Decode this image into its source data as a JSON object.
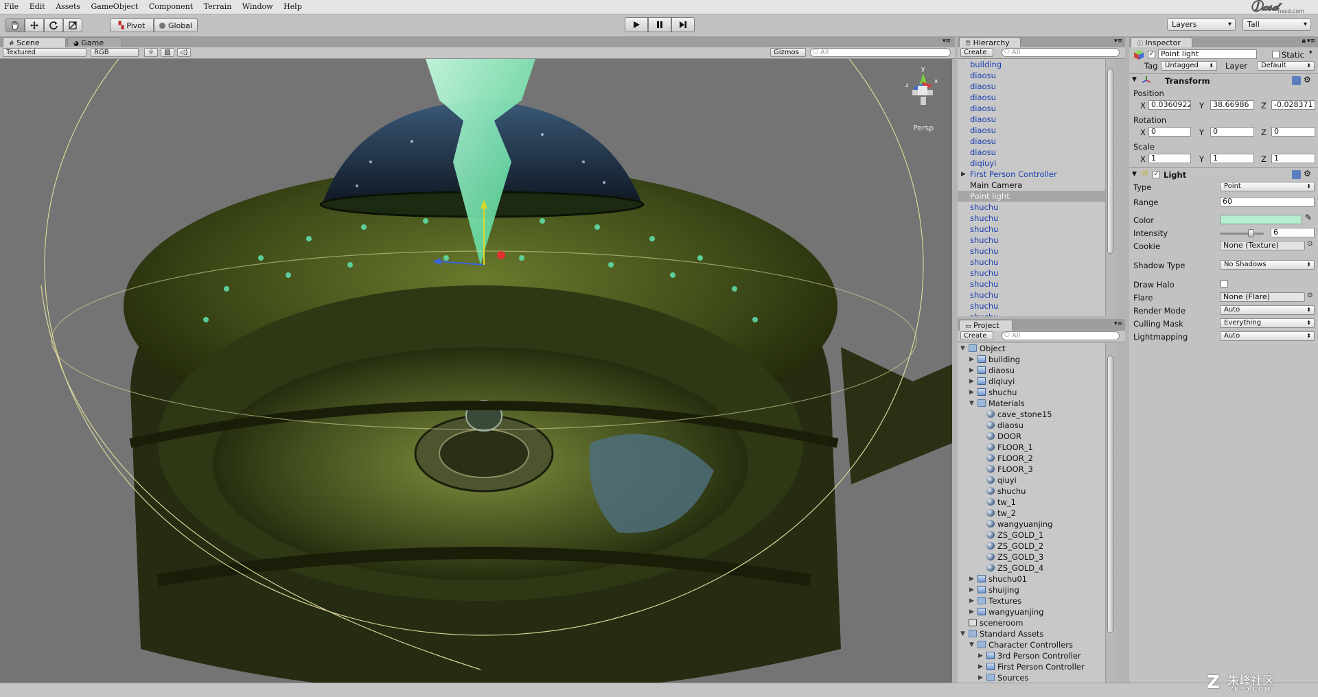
{
  "menu": [
    "File",
    "Edit",
    "Assets",
    "GameObject",
    "Component",
    "Terrain",
    "Window",
    "Help"
  ],
  "toolbar": {
    "pivot_label": "Pivot",
    "global_label": "Global",
    "layers_label": "Layers",
    "layout_label": "Tall"
  },
  "scene_panel": {
    "tab_scene": "Scene",
    "tab_game": "Game",
    "render_mode": "Textured",
    "color_mode": "RGB",
    "gizmos_label": "Gizmos",
    "search_placeholder": "All",
    "persp_label": "Persp"
  },
  "hierarchy": {
    "tab": "Hierarchy",
    "create": "Create",
    "search_placeholder": "All",
    "items": [
      {
        "label": "building",
        "style": "blue"
      },
      {
        "label": "diaosu",
        "style": "blue"
      },
      {
        "label": "diaosu",
        "style": "blue"
      },
      {
        "label": "diaosu",
        "style": "blue"
      },
      {
        "label": "diaosu",
        "style": "blue"
      },
      {
        "label": "diaosu",
        "style": "blue"
      },
      {
        "label": "diaosu",
        "style": "blue"
      },
      {
        "label": "diaosu",
        "style": "blue"
      },
      {
        "label": "diaosu",
        "style": "blue"
      },
      {
        "label": "diqiuyi",
        "style": "blue"
      },
      {
        "label": "First Person Controller",
        "style": "blue",
        "expand": true
      },
      {
        "label": "Main Camera",
        "style": "black"
      },
      {
        "label": "Point light",
        "style": "selected"
      },
      {
        "label": "shuchu",
        "style": "blue"
      },
      {
        "label": "shuchu",
        "style": "blue"
      },
      {
        "label": "shuchu",
        "style": "blue"
      },
      {
        "label": "shuchu",
        "style": "blue"
      },
      {
        "label": "shuchu",
        "style": "blue"
      },
      {
        "label": "shuchu",
        "style": "blue"
      },
      {
        "label": "shuchu",
        "style": "blue"
      },
      {
        "label": "shuchu",
        "style": "blue"
      },
      {
        "label": "shuchu",
        "style": "blue"
      },
      {
        "label": "shuchu",
        "style": "blue"
      },
      {
        "label": "shuchu",
        "style": "blue"
      }
    ]
  },
  "project": {
    "tab": "Project",
    "create": "Create",
    "search_placeholder": "All",
    "items": [
      {
        "label": "Object",
        "depth": 0,
        "icon": "folder",
        "tri": "open"
      },
      {
        "label": "building",
        "depth": 1,
        "icon": "prefab",
        "tri": "closed"
      },
      {
        "label": "diaosu",
        "depth": 1,
        "icon": "prefab",
        "tri": "closed"
      },
      {
        "label": "diqiuyi",
        "depth": 1,
        "icon": "prefab",
        "tri": "closed"
      },
      {
        "label": "shuchu",
        "depth": 1,
        "icon": "prefab",
        "tri": "closed"
      },
      {
        "label": "Materials",
        "depth": 1,
        "icon": "folder",
        "tri": "open"
      },
      {
        "label": "cave_stone15",
        "depth": 2,
        "icon": "sphere"
      },
      {
        "label": "diaosu",
        "depth": 2,
        "icon": "sphere"
      },
      {
        "label": "DOOR",
        "depth": 2,
        "icon": "sphere"
      },
      {
        "label": "FLOOR_1",
        "depth": 2,
        "icon": "sphere"
      },
      {
        "label": "FLOOR_2",
        "depth": 2,
        "icon": "sphere"
      },
      {
        "label": "FLOOR_3",
        "depth": 2,
        "icon": "sphere"
      },
      {
        "label": "qiuyi",
        "depth": 2,
        "icon": "sphere"
      },
      {
        "label": "shuchu",
        "depth": 2,
        "icon": "sphere"
      },
      {
        "label": "tw_1",
        "depth": 2,
        "icon": "sphere"
      },
      {
        "label": "tw_2",
        "depth": 2,
        "icon": "sphere"
      },
      {
        "label": "wangyuanjing",
        "depth": 2,
        "icon": "sphere"
      },
      {
        "label": "ZS_GOLD_1",
        "depth": 2,
        "icon": "sphere"
      },
      {
        "label": "ZS_GOLD_2",
        "depth": 2,
        "icon": "sphere"
      },
      {
        "label": "ZS_GOLD_3",
        "depth": 2,
        "icon": "sphere"
      },
      {
        "label": "ZS_GOLD_4",
        "depth": 2,
        "icon": "sphere"
      },
      {
        "label": "shuchu01",
        "depth": 1,
        "icon": "prefab",
        "tri": "closed"
      },
      {
        "label": "shuijing",
        "depth": 1,
        "icon": "prefab",
        "tri": "closed"
      },
      {
        "label": "Textures",
        "depth": 1,
        "icon": "folder",
        "tri": "closed"
      },
      {
        "label": "wangyuanjing",
        "depth": 1,
        "icon": "prefab",
        "tri": "closed"
      },
      {
        "label": "sceneroom",
        "depth": 0,
        "icon": "scene"
      },
      {
        "label": "Standard Assets",
        "depth": 0,
        "icon": "folder",
        "tri": "open"
      },
      {
        "label": "Character Controllers",
        "depth": 1,
        "icon": "folder",
        "tri": "open"
      },
      {
        "label": "3rd Person Controller",
        "depth": 2,
        "icon": "prefab",
        "tri": "closed"
      },
      {
        "label": "First Person Controller",
        "depth": 2,
        "icon": "prefab",
        "tri": "closed"
      },
      {
        "label": "Sources",
        "depth": 2,
        "icon": "folder",
        "tri": "closed"
      }
    ]
  },
  "inspector": {
    "tab": "Inspector",
    "object_name": "Point light",
    "static_label": "Static",
    "tag_label": "Tag",
    "tag_value": "Untagged",
    "layer_label": "Layer",
    "layer_value": "Default",
    "transform": {
      "title": "Transform",
      "position_label": "Position",
      "rotation_label": "Rotation",
      "scale_label": "Scale",
      "x": "X",
      "y": "Y",
      "z": "Z",
      "position": [
        "0.0360922",
        "38.66986",
        "-0.028371"
      ],
      "rotation": [
        "0",
        "0",
        "0"
      ],
      "scale": [
        "1",
        "1",
        "1"
      ]
    },
    "light": {
      "title": "Light",
      "type_label": "Type",
      "type_value": "Point",
      "range_label": "Range",
      "range_value": "60",
      "color_label": "Color",
      "color_value": "#b5efcf",
      "intensity_label": "Intensity",
      "intensity_value": "6",
      "intensity_fraction": 0.75,
      "cookie_label": "Cookie",
      "cookie_value": "None (Texture)",
      "shadow_label": "Shadow Type",
      "shadow_value": "No Shadows",
      "halo_label": "Draw Halo",
      "flare_label": "Flare",
      "flare_value": "None (Flare)",
      "render_label": "Render Mode",
      "render_value": "Auto",
      "culling_label": "Culling Mask",
      "culling_value": "Everything",
      "lightmap_label": "Lightmapping",
      "lightmap_value": "Auto"
    }
  },
  "watermark_top": "nxsd.com",
  "watermark_bottom_cn": "朱峰社区",
  "watermark_bottom_en": "ZF3D.COM"
}
